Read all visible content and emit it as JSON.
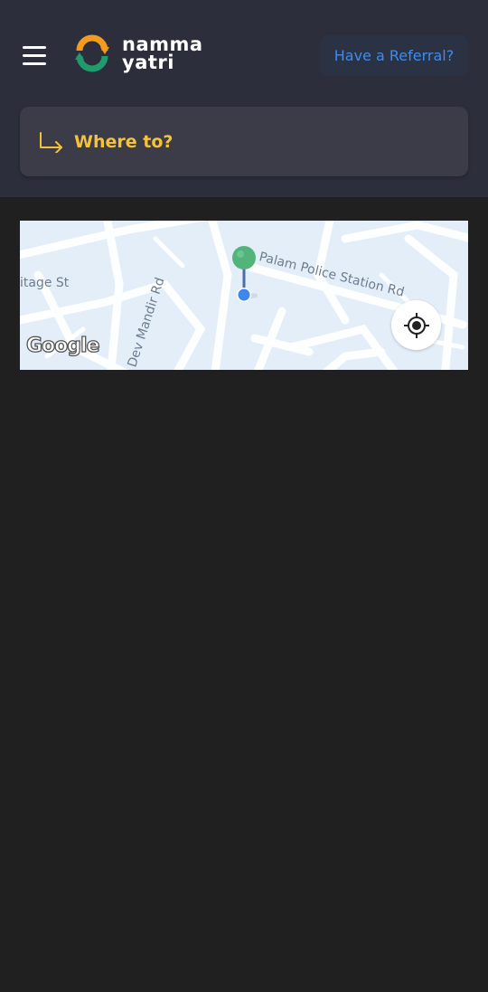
{
  "header": {
    "logo": {
      "line1": "namma",
      "line2": "yatri"
    },
    "referral_label": "Have a Referral?"
  },
  "search": {
    "label": "Where to?"
  },
  "map": {
    "streets": [
      "Palam Police Station Rd",
      "itage St",
      "a Dev Mandir Rd"
    ],
    "attribution": "Google"
  },
  "colors": {
    "header_bg": "#2c2f3b",
    "page_bg": "#202020",
    "accent_yellow": "#f5c33b",
    "accent_blue": "#3d8cf0",
    "pin_green": "#52b47a",
    "location_dot": "#3f87f0"
  },
  "icons": [
    "menu-icon",
    "arrow-turn-right-icon",
    "my-location-icon",
    "map-pin-icon"
  ]
}
